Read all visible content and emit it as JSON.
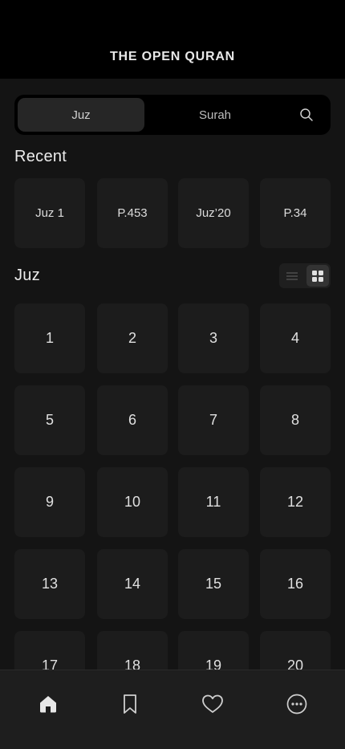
{
  "header": {
    "title": "THE OPEN QURAN"
  },
  "tabs": {
    "juz_label": "Juz",
    "surah_label": "Surah",
    "search_icon": "search-icon"
  },
  "recent": {
    "title": "Recent",
    "items": [
      "Juz 1",
      "P.453",
      "Juz’20",
      "P.34"
    ]
  },
  "juz": {
    "title": "Juz",
    "view_options": [
      "list-view-icon",
      "grid-view-icon"
    ],
    "selected_view": "grid",
    "items": [
      "1",
      "2",
      "3",
      "4",
      "5",
      "6",
      "7",
      "8",
      "9",
      "10",
      "11",
      "12",
      "13",
      "14",
      "15",
      "16",
      "17",
      "18",
      "19",
      "20"
    ]
  },
  "bottom_nav": {
    "items": [
      "home-icon",
      "bookmark-icon",
      "heart-icon",
      "more-icon"
    ],
    "active": "home-icon"
  },
  "colors": {
    "background": "#141414",
    "header": "#000000",
    "tile": "#1c1c1c",
    "text": "#e6e6e6"
  }
}
